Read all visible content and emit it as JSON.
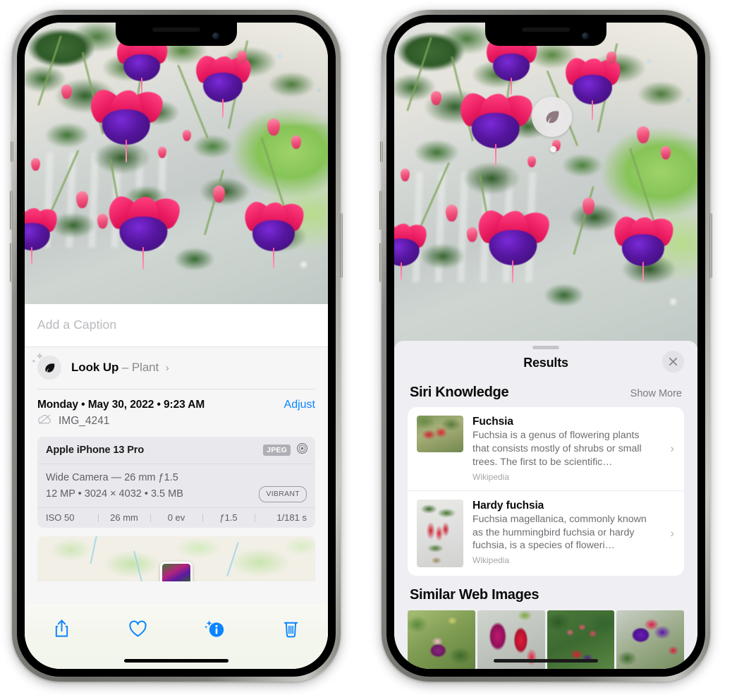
{
  "left_phone": {
    "name": "photos-detail-view",
    "caption": {
      "placeholder": "Add a Caption",
      "value": ""
    },
    "lookup_row": {
      "icon": "leaf-icon",
      "sparkle_icon": "sparkle-icon",
      "label": "Look Up",
      "separator": "–",
      "subject": "Plant",
      "chevron": "›"
    },
    "metadata": {
      "date_line": "Monday • May 30, 2022 • 9:23 AM",
      "adjust_label": "Adjust",
      "cloud_icon": "icloud-slash-icon",
      "file_name": "IMG_4241"
    },
    "exif": {
      "device": "Apple iPhone 13 Pro",
      "format_tag": "JPEG",
      "aperture_icon": "aperture-icon",
      "lens_line": "Wide Camera — 26 mm ƒ1.5",
      "size_line": "12 MP • 3024 × 4032 • 3.5 MB",
      "style_tag": "VIBRANT",
      "stats": [
        "ISO 50",
        "26 mm",
        "0 ev",
        "ƒ1.5",
        "1/181 s"
      ]
    },
    "map": {
      "name": "location-map-strip",
      "pin": "photo-pin"
    },
    "toolbar": [
      {
        "name": "share-button",
        "icon": "share-icon"
      },
      {
        "name": "favorite-button",
        "icon": "heart-icon"
      },
      {
        "name": "info-button",
        "icon": "info-sparkle-icon"
      },
      {
        "name": "delete-button",
        "icon": "trash-icon"
      }
    ]
  },
  "right_phone": {
    "name": "visual-look-up-results",
    "badge": {
      "icon": "leaf-icon",
      "name": "visual-lookup-badge"
    },
    "sheet": {
      "title": "Results",
      "close_icon": "close-icon",
      "grabber": "sheet-grabber"
    },
    "siri_knowledge": {
      "title": "Siri Knowledge",
      "show_more": "Show More",
      "items": [
        {
          "title": "Fuchsia",
          "description": "Fuchsia is a genus of flowering plants that consists mostly of shrubs or small trees. The first to be scientific…",
          "source": "Wikipedia",
          "chevron": "›",
          "thumb": "fuchsia-thumbnail"
        },
        {
          "title": "Hardy fuchsia",
          "description": "Fuchsia magellanica, commonly known as the hummingbird fuchsia or hardy fuchsia, is a species of floweri…",
          "source": "Wikipedia",
          "chevron": "›",
          "thumb": "hardy-fuchsia-thumbnail"
        }
      ]
    },
    "similar_web_images": {
      "title": "Similar Web Images",
      "thumbs": [
        "web-image-1",
        "web-image-2",
        "web-image-3",
        "web-image-4"
      ]
    }
  },
  "colors": {
    "accent_blue": "#0A84FF",
    "sheet_bg": "#EFEFF3",
    "card_bg": "#FFFFFF",
    "left_sheet_bg": "#F6F6F7",
    "exif_card_bg": "#E9E9ED",
    "muted_text": "#8A8A8E"
  }
}
